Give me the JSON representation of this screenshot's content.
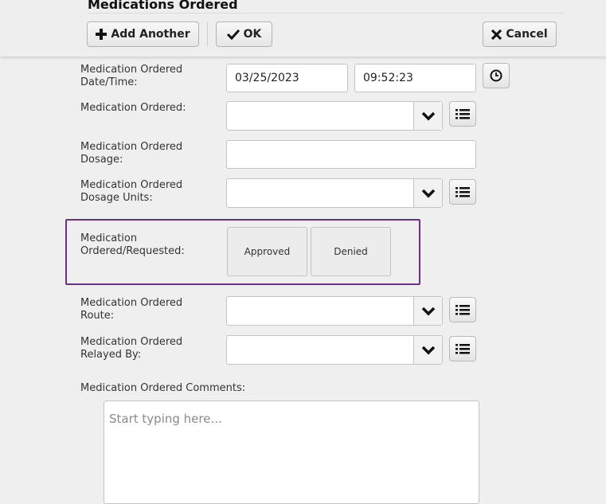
{
  "header": {
    "title": "Medications Ordered",
    "add_another_label": "Add Another",
    "ok_label": "OK",
    "cancel_label": "Cancel"
  },
  "form": {
    "datetime": {
      "label_line1": "Medication Ordered",
      "label_line2": "Date/Time:",
      "date_value": "03/25/2023",
      "time_value": "09:52:23"
    },
    "medication": {
      "label": "Medication Ordered:",
      "value": ""
    },
    "dosage": {
      "label_line1": "Medication Ordered",
      "label_line2": "Dosage:",
      "value": ""
    },
    "dosage_units": {
      "label_line1": "Medication Ordered",
      "label_line2": "Dosage Units:",
      "value": ""
    },
    "requested": {
      "label_line1": "Medication",
      "label_line2": "Ordered/Requested:",
      "options": [
        "Approved",
        "Denied"
      ]
    },
    "route": {
      "label_line1": "Medication Ordered",
      "label_line2": "Route:",
      "value": ""
    },
    "relayed_by": {
      "label_line1": "Medication Ordered",
      "label_line2": "Relayed By:",
      "value": ""
    },
    "comments": {
      "label": "Medication Ordered Comments:",
      "placeholder": "Start typing here..."
    }
  },
  "colors": {
    "highlight_border": "#6b2f8c"
  }
}
